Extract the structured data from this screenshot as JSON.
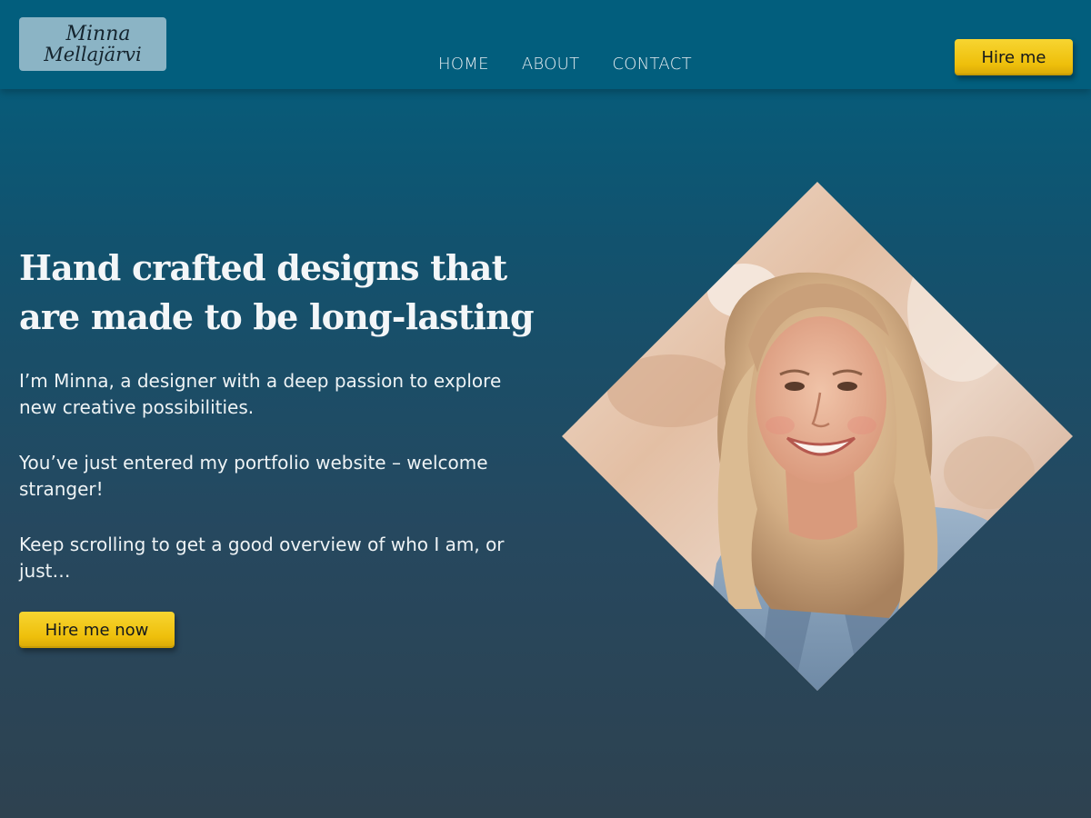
{
  "logo": {
    "line1": "Minna",
    "line2": "Mellajärvi"
  },
  "nav": {
    "links": [
      "HOME",
      "ABOUT",
      "CONTACT"
    ],
    "hire_label": "Hire me"
  },
  "hero": {
    "heading": "Hand crafted designs that are made to be long-lasting",
    "paragraphs": [
      "I’m Minna, a designer with a deep passion to explore new creative possibilities.",
      "You’ve just entered my portfolio website – welcome stranger!",
      "Keep scrolling to get a good overview of who I am, or just…"
    ],
    "cta_label": "Hire me now"
  },
  "colors": {
    "header_bg": "#025e7d",
    "accent_yellow": "#f2c80f",
    "logo_bg": "#8bb4c5",
    "text": "#eef3f5"
  }
}
